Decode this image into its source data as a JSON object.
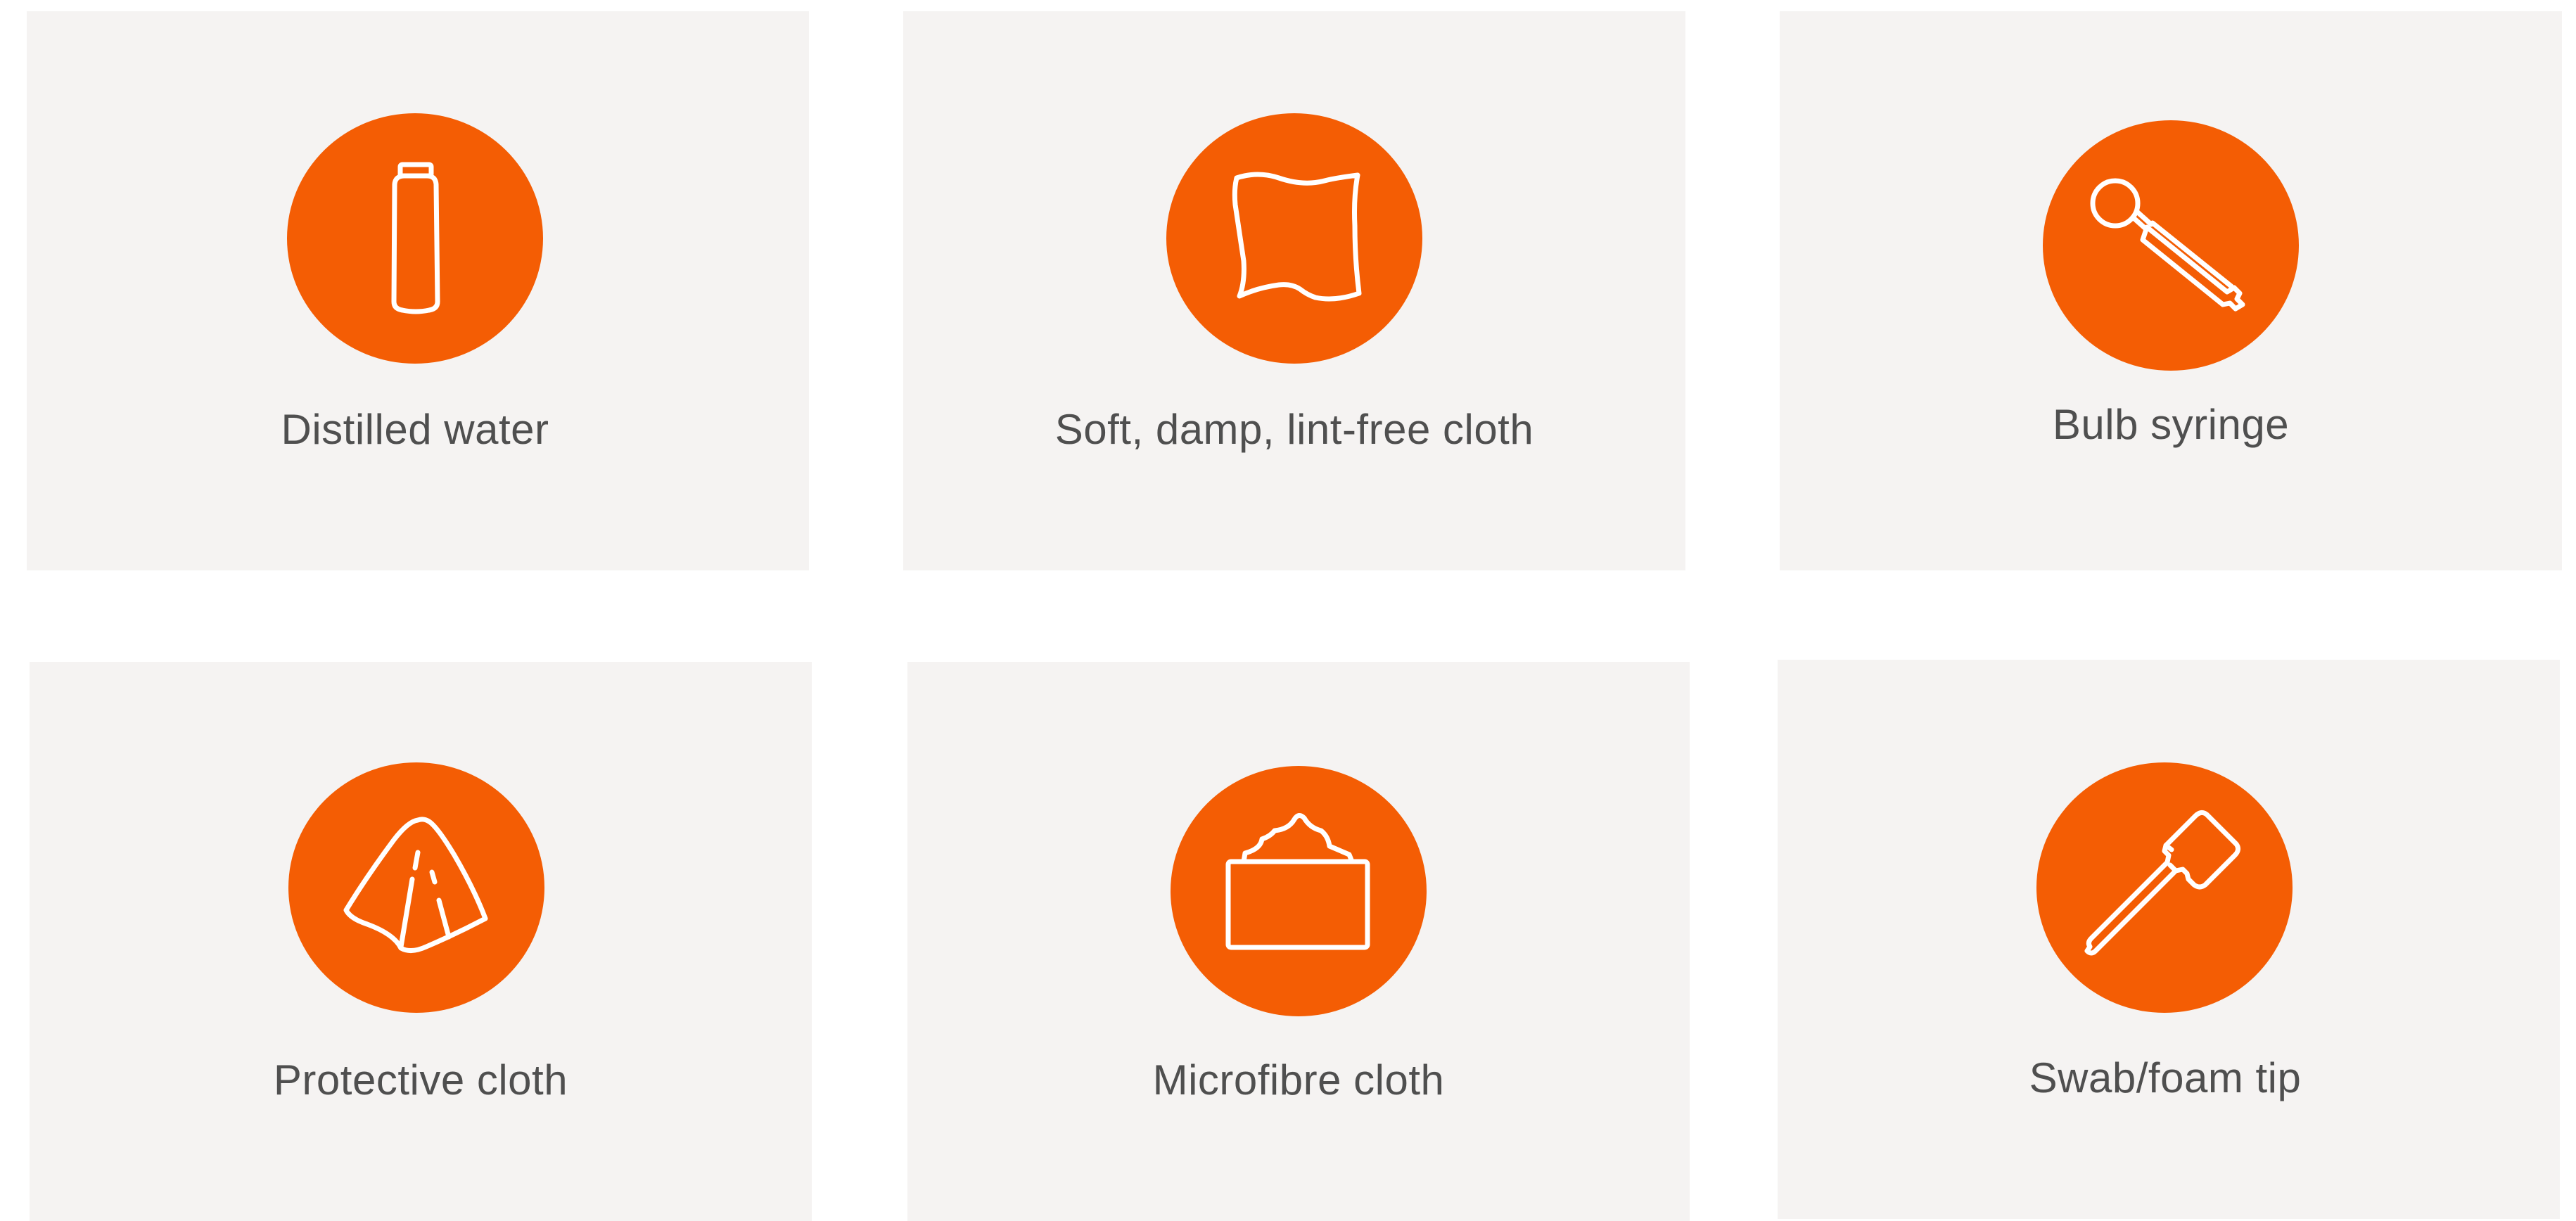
{
  "items": [
    {
      "label": "Distilled water",
      "icon": "bottle-icon"
    },
    {
      "label": "Soft, damp, lint-free cloth",
      "icon": "cloth-icon"
    },
    {
      "label": "Bulb syringe",
      "icon": "bulb-syringe-icon"
    },
    {
      "label": "Protective cloth",
      "icon": "protective-cloth-icon"
    },
    {
      "label": "Microfibre cloth",
      "icon": "microfibre-cloth-box-icon"
    },
    {
      "label": "Swab/foam tip",
      "icon": "swab-icon"
    }
  ],
  "colors": {
    "card_background": "#f5f3f2",
    "icon_circle": "#f45d04",
    "icon_stroke": "#ffffff",
    "label_text": "#4f4f4f"
  }
}
